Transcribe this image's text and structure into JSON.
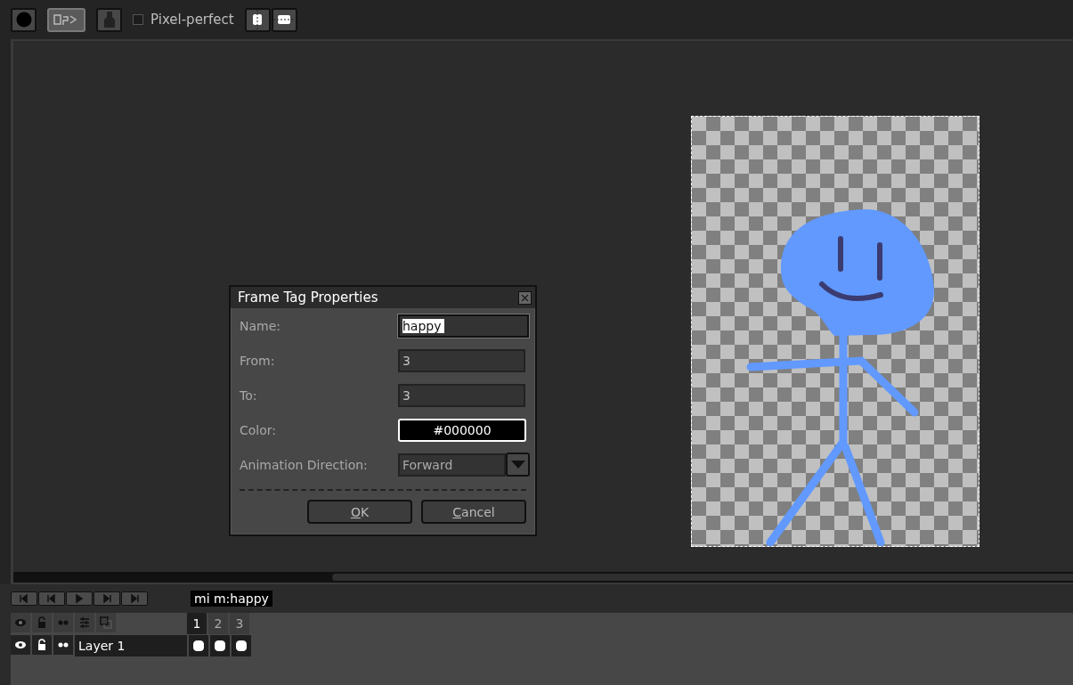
{
  "toolbar": {
    "buttons": [
      {
        "kind": "circle",
        "selected": false
      },
      {
        "kind": "ink",
        "selected": true
      },
      {
        "kind": "shade",
        "selected": false
      }
    ],
    "pixel_perfect": {
      "label": "Pixel-perfect",
      "checked": false
    },
    "symmetry": [
      {
        "kind": "vertical",
        "selected": false
      },
      {
        "kind": "horizontal",
        "selected": false
      }
    ]
  },
  "dialog": {
    "title": "Frame Tag Properties",
    "fields": [
      {
        "kind": "text",
        "label": "Name:",
        "value": "happy",
        "selected": true
      },
      {
        "kind": "text",
        "label": "From:",
        "value": "3",
        "selected": false
      },
      {
        "kind": "text",
        "label": "To:",
        "value": "3",
        "selected": false
      },
      {
        "kind": "color",
        "label": "Color:",
        "value": "#000000",
        "color": "#000000"
      },
      {
        "kind": "select",
        "label": "Animation Direction:",
        "value": "Forward"
      }
    ],
    "buttons": [
      {
        "key": "O",
        "rest": "K"
      },
      {
        "key": "C",
        "rest": "ancel"
      }
    ]
  },
  "timeline": {
    "tag": {
      "label": "mi m:happy"
    },
    "frames": [
      {
        "label": "1",
        "selected": true
      },
      {
        "label": "2",
        "selected": false
      },
      {
        "label": "3",
        "selected": false
      }
    ],
    "layers": [
      {
        "name": "Layer 1",
        "cels": [
          true,
          true,
          true
        ]
      }
    ]
  }
}
